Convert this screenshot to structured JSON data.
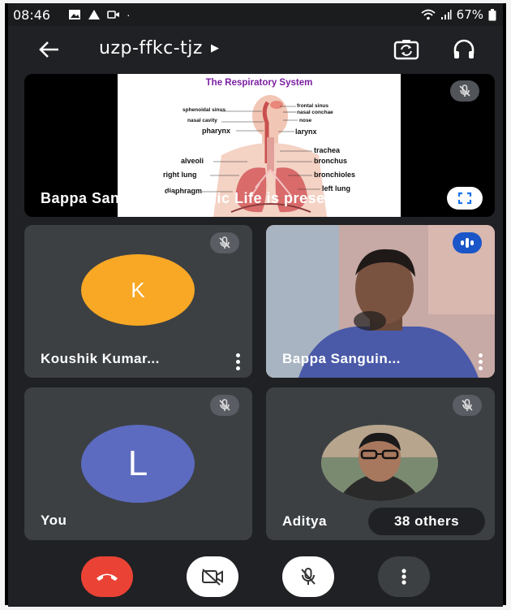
{
  "status_bar": {
    "time": "08:46",
    "battery": "67%"
  },
  "meeting": {
    "code": "uzp-ffkc-tjz"
  },
  "presentation": {
    "caption": "Bappa Sanguin - Dynamic Life is presenti...",
    "slide": {
      "title": "The Respiratory System",
      "labels": {
        "sphenoidal_sinus": "sphenoidal sinus",
        "frontal_sinus": "frontal sinus",
        "nasal_conchae": "nasal conchae",
        "nasal_cavity": "nasal cavity",
        "nose": "nose",
        "pharynx": "pharynx",
        "larynx": "larynx",
        "trachea": "trachea",
        "alveoli": "alveoli",
        "bronchus": "bronchus",
        "right_lung": "right lung",
        "bronchioles": "bronchioles",
        "diaphragm": "diaphragm",
        "left_lung": "left lung"
      }
    }
  },
  "participants": [
    {
      "name": "Koushik Kumar...",
      "initial": "K",
      "avatar_color": "#f9a825",
      "muted": true
    },
    {
      "name": "Bappa Sanguin...",
      "speaking": true
    },
    {
      "name": "You",
      "initial": "L",
      "avatar_color": "#5c6bc0",
      "muted": true
    },
    {
      "name": "Aditya",
      "muted": true,
      "others_badge": "38 others"
    }
  ],
  "controls": {
    "end_call_color": "#ea4335",
    "camera_state": "off",
    "mic_state": "off"
  }
}
